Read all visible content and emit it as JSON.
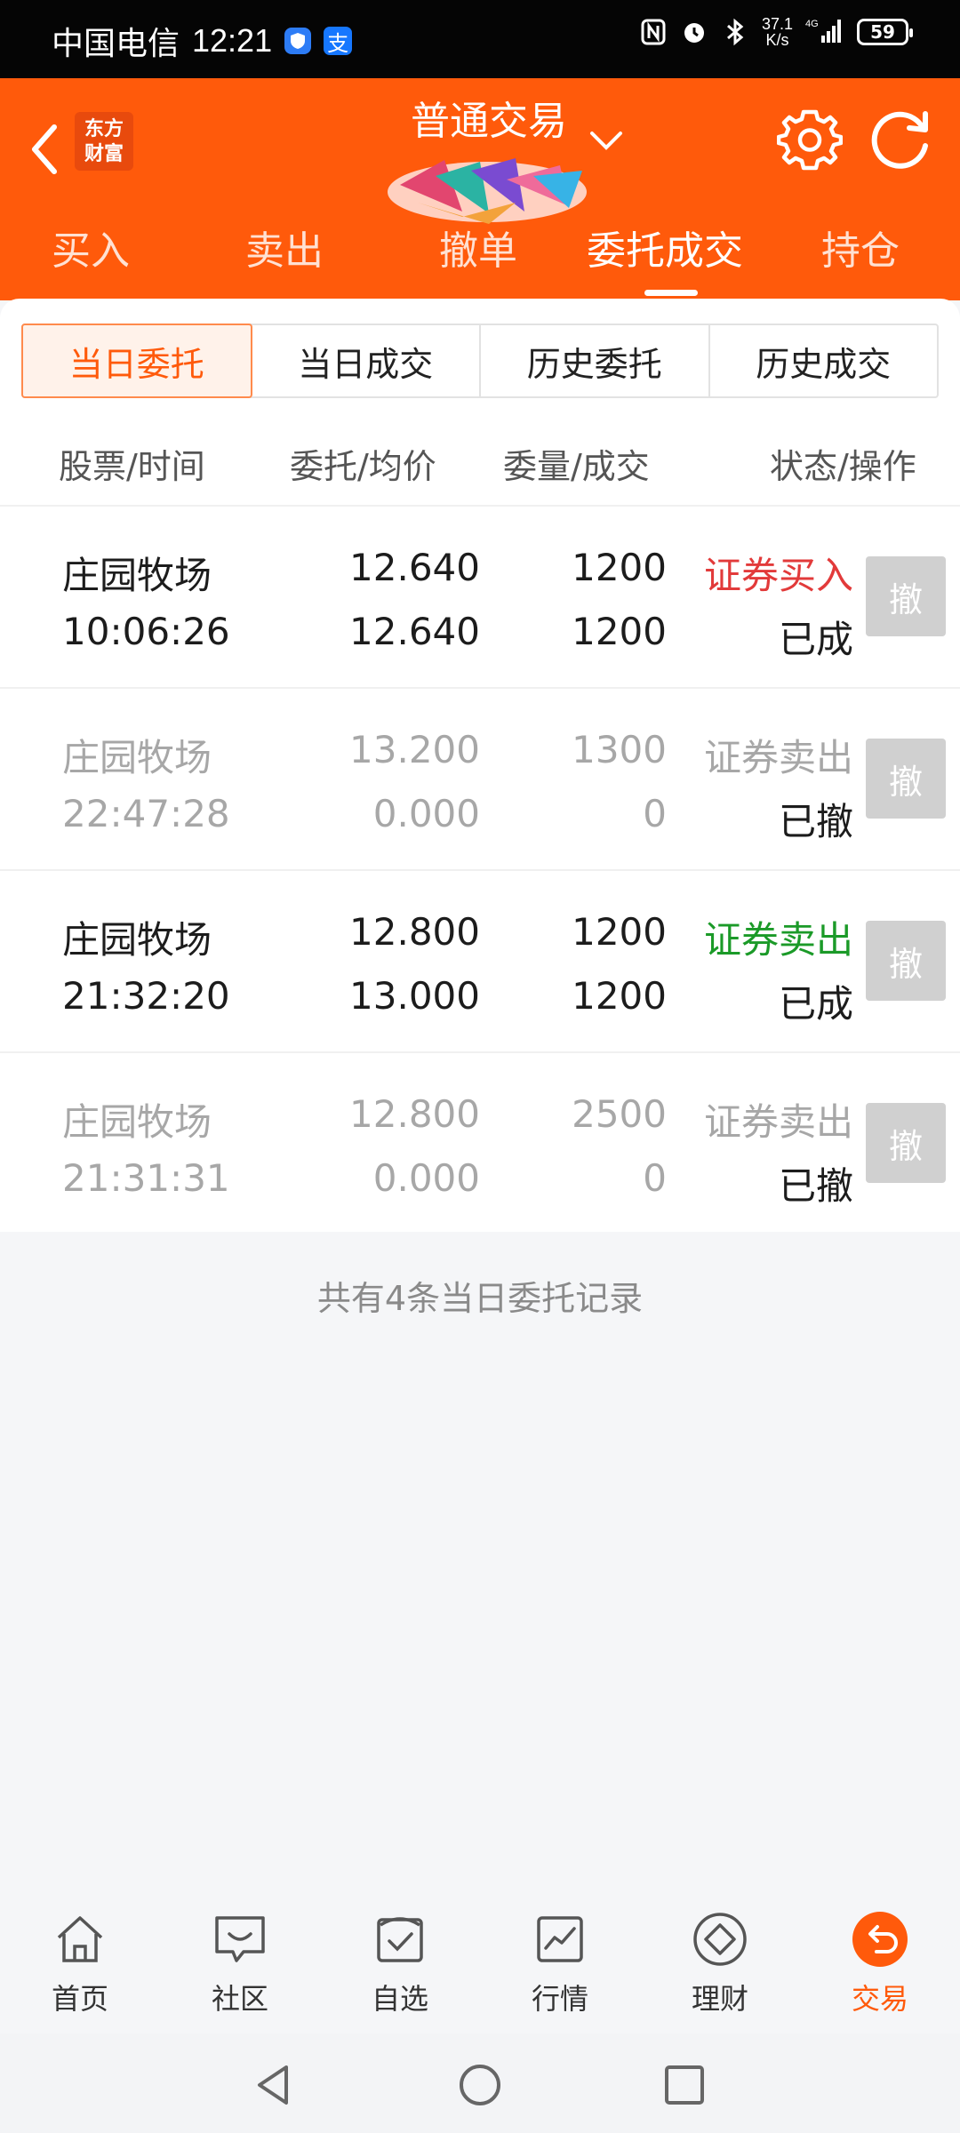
{
  "status_bar": {
    "carrier": "中国电信",
    "time": "12:21",
    "pay_icon_label": "支",
    "speed_value": "37.1",
    "speed_unit": "K/s",
    "network": "4G",
    "battery": "59"
  },
  "header": {
    "logo_line1": "东方",
    "logo_line2": "财富",
    "title": "普通交易",
    "tabs": [
      {
        "label": "买入"
      },
      {
        "label": "卖出"
      },
      {
        "label": "撤单"
      },
      {
        "label": "委托成交"
      },
      {
        "label": "持仓"
      }
    ],
    "active_tab": "委托成交"
  },
  "segments": [
    {
      "label": "当日委托"
    },
    {
      "label": "当日成交"
    },
    {
      "label": "历史委托"
    },
    {
      "label": "历史成交"
    }
  ],
  "active_segment": "当日委托",
  "columns": {
    "col1": "股票/时间",
    "col2": "委托/均价",
    "col3": "委量/成交",
    "col4": "状态/操作"
  },
  "orders": [
    {
      "name": "庄园牧场",
      "time": "10:06:26",
      "price": "12.640",
      "avg": "12.640",
      "qty": "1200",
      "filled": "1200",
      "side": "证券买入",
      "state": "已成",
      "cancel": "撤"
    },
    {
      "name": "庄园牧场",
      "time": "22:47:28",
      "price": "13.200",
      "avg": "0.000",
      "qty": "1300",
      "filled": "0",
      "side": "证券卖出",
      "state": "已撤",
      "cancel": "撤"
    },
    {
      "name": "庄园牧场",
      "time": "21:32:20",
      "price": "12.800",
      "avg": "13.000",
      "qty": "1200",
      "filled": "1200",
      "side": "证券卖出",
      "state": "已成",
      "cancel": "撤"
    },
    {
      "name": "庄园牧场",
      "time": "21:31:31",
      "price": "12.800",
      "avg": "0.000",
      "qty": "2500",
      "filled": "0",
      "side": "证券卖出",
      "state": "已撤",
      "cancel": "撤"
    }
  ],
  "summary": "共有4条当日委托记录",
  "bottom_nav": [
    {
      "label": "首页",
      "icon": "home-icon"
    },
    {
      "label": "社区",
      "icon": "community-icon"
    },
    {
      "label": "自选",
      "icon": "watchlist-icon"
    },
    {
      "label": "行情",
      "icon": "market-icon"
    },
    {
      "label": "理财",
      "icon": "wealth-icon"
    },
    {
      "label": "交易",
      "icon": "trade-icon"
    }
  ],
  "active_nav": "交易",
  "colors": {
    "brand": "#ff5a0b",
    "buy": "#e23a3a",
    "sell": "#1b9a28",
    "muted": "#a7a7a7"
  }
}
